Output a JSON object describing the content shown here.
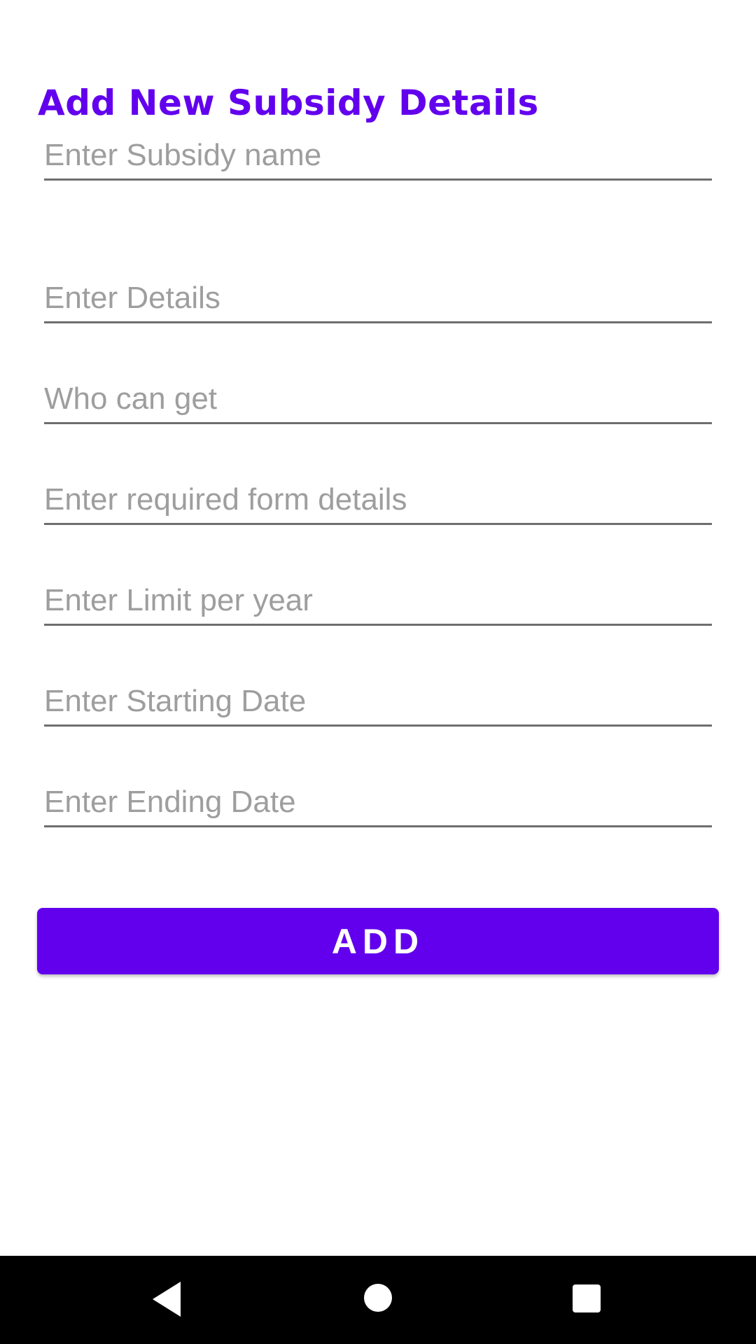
{
  "form": {
    "title": "Add New Subsidy Details",
    "fields": [
      {
        "placeholder": "Enter Subsidy name",
        "value": ""
      },
      {
        "placeholder": "Enter Details",
        "value": ""
      },
      {
        "placeholder": "Who can get",
        "value": ""
      },
      {
        "placeholder": "Enter required form details",
        "value": ""
      },
      {
        "placeholder": "Enter Limit per year",
        "value": ""
      },
      {
        "placeholder": "Enter Starting Date",
        "value": ""
      },
      {
        "placeholder": "Enter Ending Date",
        "value": ""
      }
    ],
    "submit_label": "ADD"
  },
  "navigation_bar": {
    "buttons": [
      {
        "icon": "back-triangle-icon"
      },
      {
        "icon": "home-circle-icon"
      },
      {
        "icon": "recents-square-icon"
      }
    ]
  },
  "colors": {
    "accent": "#6200ee",
    "placeholder": "#9e9e9e",
    "underline": "#6e6e6e",
    "nav_bar": "#000000"
  }
}
